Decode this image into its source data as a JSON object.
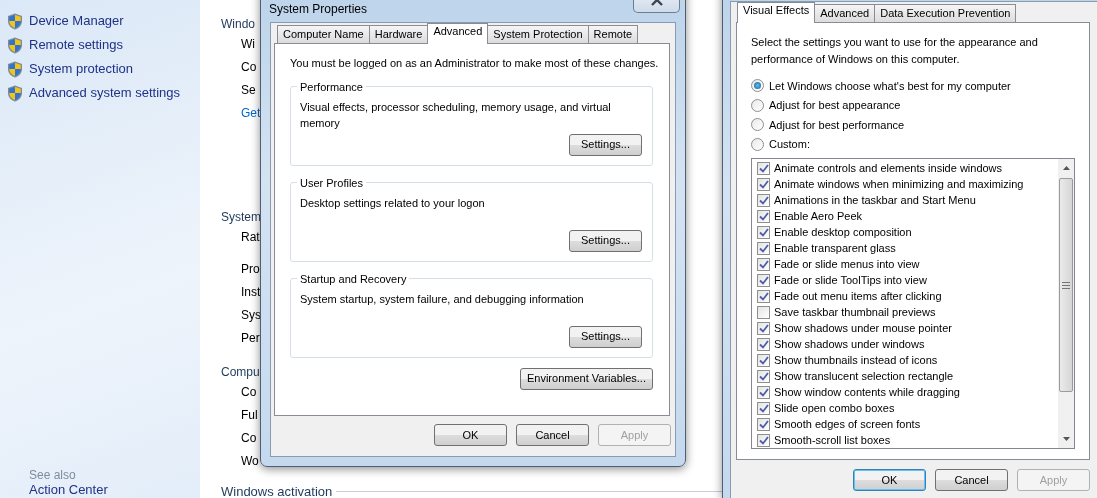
{
  "sidebar": {
    "items": [
      {
        "label": "Device Manager"
      },
      {
        "label": "Remote settings"
      },
      {
        "label": "System protection"
      },
      {
        "label": "Advanced system settings"
      }
    ],
    "see_also": "See also",
    "links": [
      "Action Center"
    ]
  },
  "background": {
    "sections": [
      {
        "heading": "Windo",
        "items": [
          {
            "text": "Wi",
            "kind": "text"
          },
          {
            "text": "Co",
            "kind": "text"
          },
          {
            "text": "Se",
            "kind": "text"
          },
          {
            "text": "Get",
            "kind": "link"
          }
        ]
      },
      {
        "heading": "System",
        "items": [
          {
            "text": "Rat",
            "kind": "text"
          },
          {
            "text": "Pro",
            "kind": "text"
          },
          {
            "text": "Inst",
            "kind": "text"
          },
          {
            "text": "Sys",
            "kind": "text"
          },
          {
            "text": "Per",
            "kind": "text"
          }
        ]
      },
      {
        "heading": "Compu",
        "items": [
          {
            "text": "Co",
            "kind": "text"
          },
          {
            "text": "Ful",
            "kind": "text"
          },
          {
            "text": "Co",
            "kind": "text"
          },
          {
            "text": "Wo",
            "kind": "text"
          }
        ]
      }
    ],
    "activation": "Windows activation"
  },
  "system_properties": {
    "title": "System Properties",
    "tabs": [
      {
        "label": "Computer Name",
        "selected": false
      },
      {
        "label": "Hardware",
        "selected": false
      },
      {
        "label": "Advanced",
        "selected": true
      },
      {
        "label": "System Protection",
        "selected": false
      },
      {
        "label": "Remote",
        "selected": false
      }
    ],
    "notice": "You must be logged on as an Administrator to make most of these changes.",
    "groups": [
      {
        "title": "Performance",
        "description": "Visual effects, processor scheduling, memory usage, and virtual memory",
        "button": "Settings..."
      },
      {
        "title": "User Profiles",
        "description": "Desktop settings related to your logon",
        "button": "Settings..."
      },
      {
        "title": "Startup and Recovery",
        "description": "System startup, system failure, and debugging information",
        "button": "Settings..."
      }
    ],
    "env_button": "Environment Variables...",
    "buttons": [
      {
        "label": "OK",
        "disabled": false
      },
      {
        "label": "Cancel",
        "disabled": false
      },
      {
        "label": "Apply",
        "disabled": true
      }
    ]
  },
  "performance_options": {
    "tabs": [
      {
        "label": "Visual Effects",
        "selected": true
      },
      {
        "label": "Advanced",
        "selected": false
      },
      {
        "label": "Data Execution Prevention",
        "selected": false
      }
    ],
    "intro": "Select the settings you want to use for the appearance and performance of Windows on this computer.",
    "options": [
      {
        "label": "Let Windows choose what's best for my computer",
        "selected": true
      },
      {
        "label": "Adjust for best appearance",
        "selected": false
      },
      {
        "label": "Adjust for best performance",
        "selected": false
      },
      {
        "label": "Custom:",
        "selected": false
      }
    ],
    "effects": [
      {
        "label": "Animate controls and elements inside windows",
        "checked": true
      },
      {
        "label": "Animate windows when minimizing and maximizing",
        "checked": true
      },
      {
        "label": "Animations in the taskbar and Start Menu",
        "checked": true
      },
      {
        "label": "Enable Aero Peek",
        "checked": true
      },
      {
        "label": "Enable desktop composition",
        "checked": true
      },
      {
        "label": "Enable transparent glass",
        "checked": true
      },
      {
        "label": "Fade or slide menus into view",
        "checked": true
      },
      {
        "label": "Fade or slide ToolTips into view",
        "checked": true
      },
      {
        "label": "Fade out menu items after clicking",
        "checked": true
      },
      {
        "label": "Save taskbar thumbnail previews",
        "checked": false
      },
      {
        "label": "Show shadows under mouse pointer",
        "checked": true
      },
      {
        "label": "Show shadows under windows",
        "checked": true
      },
      {
        "label": "Show thumbnails instead of icons",
        "checked": true
      },
      {
        "label": "Show translucent selection rectangle",
        "checked": true
      },
      {
        "label": "Show window contents while dragging",
        "checked": true
      },
      {
        "label": "Slide open combo boxes",
        "checked": true
      },
      {
        "label": "Smooth edges of screen fonts",
        "checked": true
      },
      {
        "label": "Smooth-scroll list boxes",
        "checked": true
      }
    ],
    "buttons": [
      {
        "label": "OK",
        "disabled": false,
        "default": true
      },
      {
        "label": "Cancel",
        "disabled": false,
        "default": false
      },
      {
        "label": "Apply",
        "disabled": true,
        "default": false
      }
    ]
  }
}
